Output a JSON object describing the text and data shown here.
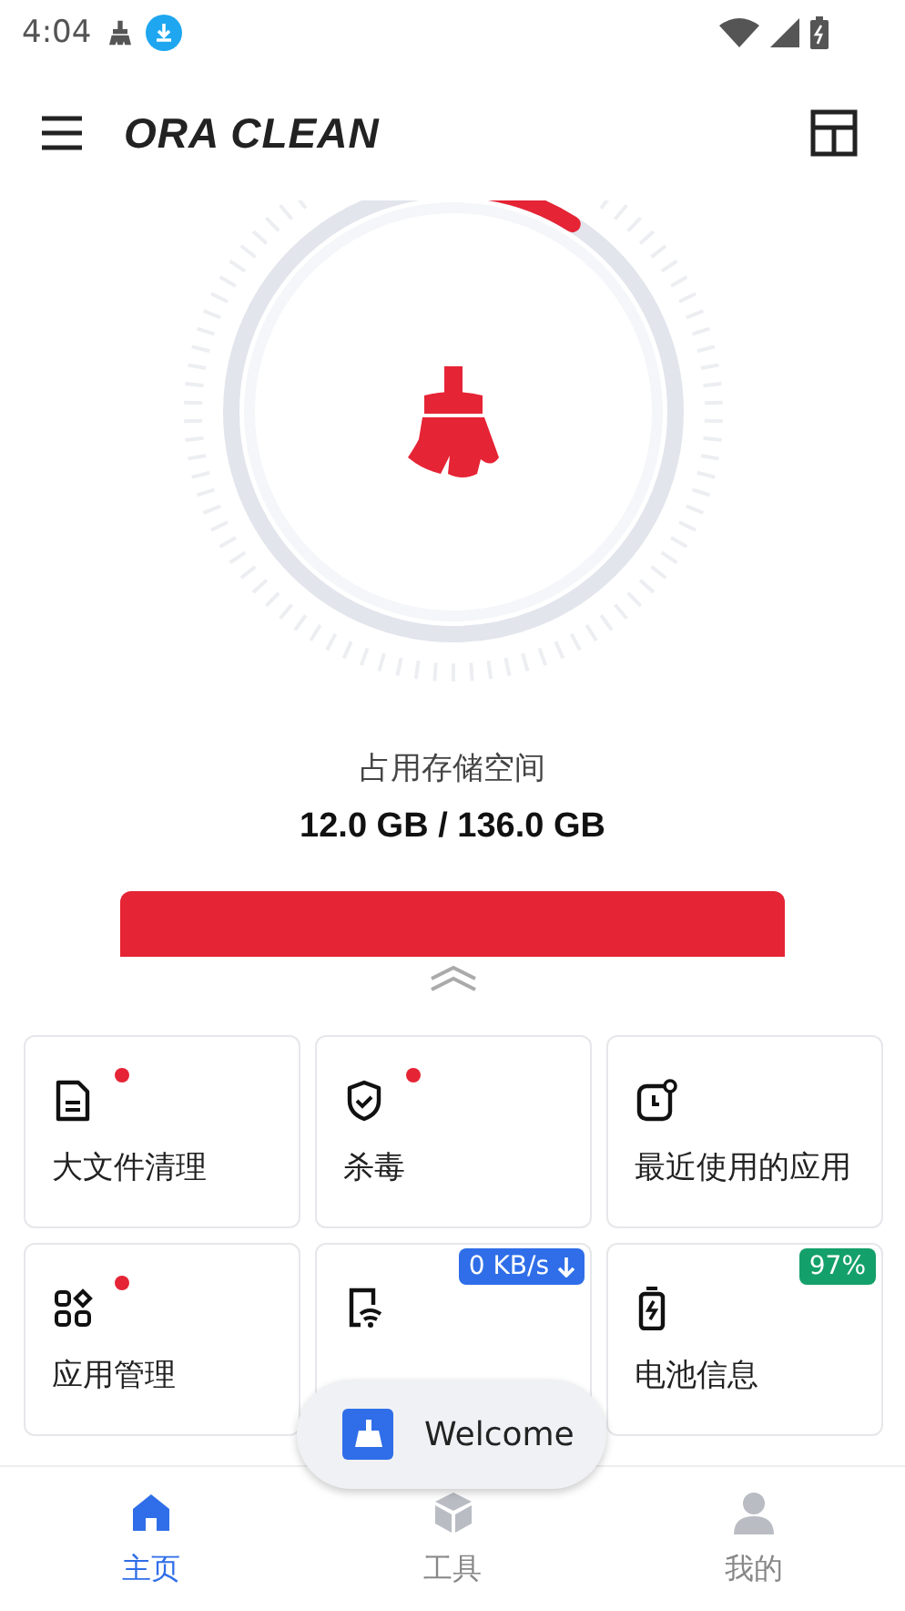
{
  "status_bar": {
    "time": "4:04"
  },
  "header": {
    "title": "ORA CLEAN"
  },
  "storage": {
    "level": 0.09,
    "label": "占用存储空间",
    "value": "12.0 GB / 136.0 GB"
  },
  "tools": [
    {
      "label": "大文件清理",
      "new_dot": true
    },
    {
      "label": "杀毒",
      "new_dot": true
    },
    {
      "label": "最近使用的应用",
      "new_dot": false
    },
    {
      "label": "应用管理",
      "new_dot": true
    },
    {
      "new_dot": false,
      "badge": {
        "text": "0 KB/s",
        "color": "#2f6ee8",
        "kind": "download"
      }
    },
    {
      "label": "电池信息",
      "new_dot": false,
      "badge": {
        "text": "97%",
        "color": "#14a06a",
        "kind": "plain"
      }
    }
  ],
  "toast": {
    "text": "Welcome"
  },
  "nav": [
    {
      "label": "主页",
      "selected": true
    },
    {
      "label": "工具",
      "selected": false
    },
    {
      "label": "我的",
      "selected": false
    }
  ]
}
